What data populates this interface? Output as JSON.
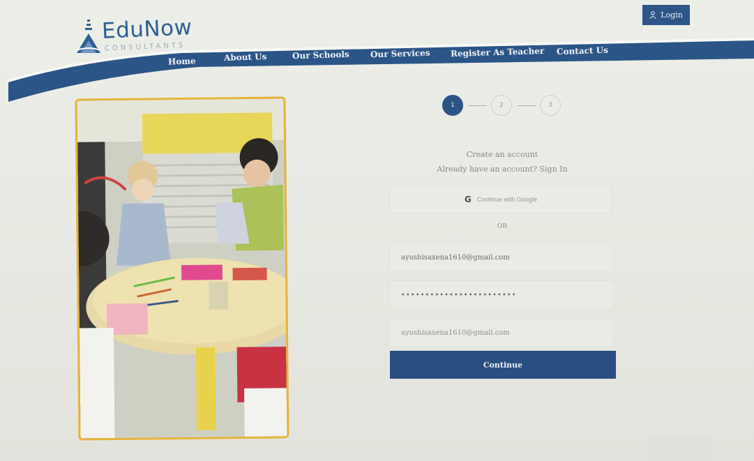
{
  "brand": {
    "name": "EduNow",
    "tagline": "CONSULTANTS",
    "logo_icon": "pyramid-logo-icon",
    "primary_color": "#2e5587",
    "accent_color": "#e7b33a"
  },
  "header": {
    "login_label": "Login",
    "login_icon": "user-icon"
  },
  "nav": {
    "items": [
      {
        "label": "Home"
      },
      {
        "label": "About Us"
      },
      {
        "label": "Our Schools"
      },
      {
        "label": "Our Services"
      },
      {
        "label": "Register As Teacher"
      },
      {
        "label": "Contact Us"
      }
    ]
  },
  "stepper": {
    "steps": [
      {
        "label": "1",
        "active": true
      },
      {
        "label": "2",
        "active": false
      },
      {
        "label": "3",
        "active": false
      }
    ]
  },
  "form": {
    "create_text": "Create an account",
    "signin_prompt": "Already have an account?",
    "signin_link": "Sign In",
    "google_label": "Continue with Google",
    "google_icon": "google-g-icon",
    "or_label": "OR",
    "email_value": "ayushisaxena1610@gmail.com",
    "password_value": "••••••••••••••••••••••••",
    "confirm_email_value": "ayushisaxena1610@gmail.com",
    "continue_label": "Continue"
  }
}
